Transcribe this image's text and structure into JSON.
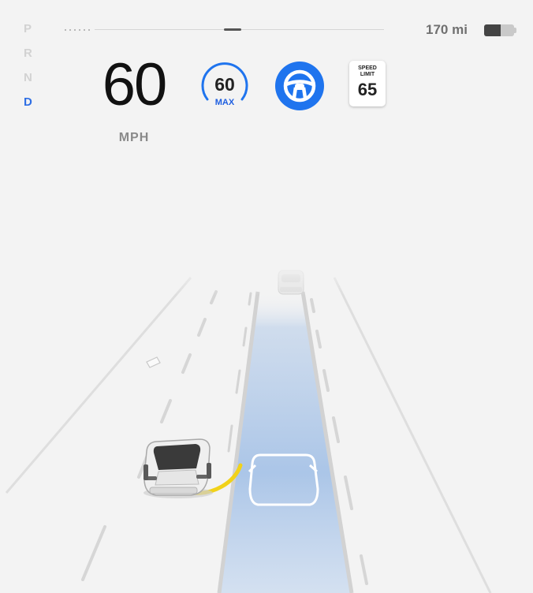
{
  "gear_selector": {
    "gears": [
      "P",
      "R",
      "N",
      "D"
    ],
    "active": "D"
  },
  "status_bar": {
    "range": "170 mi",
    "battery_level": 0.55
  },
  "speedometer": {
    "speed": "60",
    "unit": "MPH"
  },
  "set_speed": {
    "value": "60",
    "label": "MAX"
  },
  "autosteer": {
    "icon": "steering-wheel-icon",
    "state": "active"
  },
  "speed_limit_sign": {
    "line1": "SPEED",
    "line2": "LIMIT",
    "value": "65"
  },
  "colors": {
    "accent_blue": "#1f74ee",
    "active_gear": "#2f6fe4",
    "lane_path": "#a9c5ea",
    "lane_change_path": "#f1d21a",
    "background": "#f3f3f3"
  }
}
